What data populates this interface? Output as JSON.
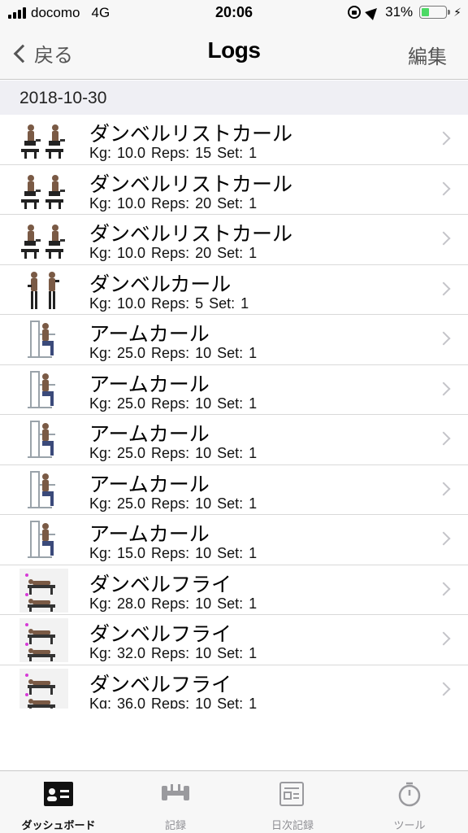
{
  "status_bar": {
    "carrier": "docomo",
    "network": "4G",
    "time": "20:06",
    "battery": "31%",
    "battery_level": 0.31
  },
  "nav": {
    "back_label": "戻る",
    "title": "Logs",
    "edit_label": "編集"
  },
  "section": {
    "date": "2018-10-30"
  },
  "logs": [
    {
      "name": "ダンベルリストカール",
      "detail": "Kg: 10.0  Reps: 15  Set: 1",
      "thumb": "seated-dumbbell-icon"
    },
    {
      "name": "ダンベルリストカール",
      "detail": "Kg: 10.0  Reps: 20  Set: 1",
      "thumb": "seated-dumbbell-icon"
    },
    {
      "name": "ダンベルリストカール",
      "detail": "Kg: 10.0  Reps: 20  Set: 1",
      "thumb": "seated-dumbbell-icon"
    },
    {
      "name": "ダンベルカール",
      "detail": "Kg: 10.0  Reps: 5  Set: 1",
      "thumb": "standing-dumbbell-icon"
    },
    {
      "name": "アームカール",
      "detail": "Kg: 25.0  Reps: 10  Set: 1",
      "thumb": "machine-curl-icon"
    },
    {
      "name": "アームカール",
      "detail": "Kg: 25.0  Reps: 10  Set: 1",
      "thumb": "machine-curl-icon"
    },
    {
      "name": "アームカール",
      "detail": "Kg: 25.0  Reps: 10  Set: 1",
      "thumb": "machine-curl-icon"
    },
    {
      "name": "アームカール",
      "detail": "Kg: 25.0  Reps: 10  Set: 1",
      "thumb": "machine-curl-icon"
    },
    {
      "name": "アームカール",
      "detail": "Kg: 15.0  Reps: 10  Set: 1",
      "thumb": "machine-curl-icon"
    },
    {
      "name": "ダンベルフライ",
      "detail": "Kg: 28.0  Reps: 10  Set: 1",
      "thumb": "bench-fly-icon"
    },
    {
      "name": "ダンベルフライ",
      "detail": "Kg: 32.0  Reps: 10  Set: 1",
      "thumb": "bench-fly-icon"
    },
    {
      "name": "ダンベルフライ",
      "detail": "Kg: 36.0  Reps: 10  Set: 1",
      "thumb": "bench-fly-icon"
    }
  ],
  "tabs": [
    {
      "label": "ダッシュボード",
      "icon": "dashboard-icon",
      "active": true
    },
    {
      "label": "記録",
      "icon": "dumbbell-icon",
      "active": false
    },
    {
      "label": "日次記録",
      "icon": "daily-log-icon",
      "active": false
    },
    {
      "label": "ツール",
      "icon": "stopwatch-icon",
      "active": false
    }
  ],
  "colors": {
    "bar_bg": "#f7f7f7",
    "section_bg": "#efeff4",
    "battery_green": "#4cd964",
    "inactive_tab": "#8e8e93"
  }
}
